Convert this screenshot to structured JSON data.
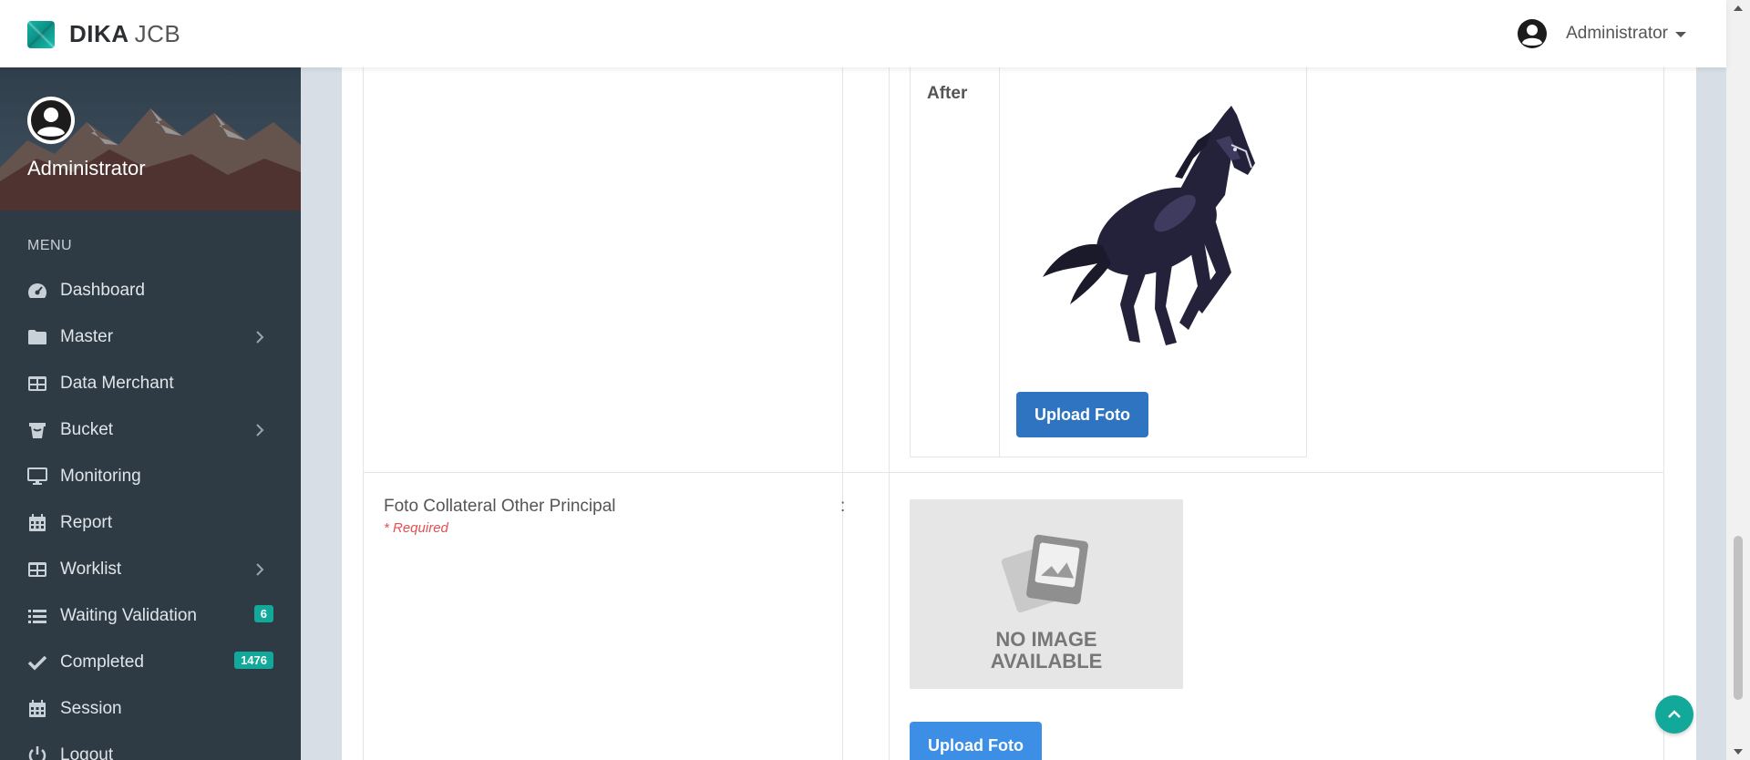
{
  "brand": {
    "name": "DIKA",
    "sub": "JCB"
  },
  "header": {
    "user_name": "Administrator"
  },
  "sidebar": {
    "profile_name": "Administrator",
    "menu_title": "MENU",
    "items": [
      {
        "label": "Dashboard",
        "icon": "dashboard-icon"
      },
      {
        "label": "Master",
        "icon": "folder-icon",
        "has_submenu": true
      },
      {
        "label": "Data Merchant",
        "icon": "table-icon"
      },
      {
        "label": "Bucket",
        "icon": "bucket-icon",
        "has_submenu": true
      },
      {
        "label": "Monitoring",
        "icon": "monitor-icon"
      },
      {
        "label": "Report",
        "icon": "calendar-icon"
      },
      {
        "label": "Worklist",
        "icon": "table-icon",
        "has_submenu": true
      },
      {
        "label": "Waiting Validation",
        "icon": "list-icon",
        "badge": "6"
      },
      {
        "label": "Completed",
        "icon": "check-icon",
        "badge": "1476"
      },
      {
        "label": "Session",
        "icon": "calendar-icon"
      },
      {
        "label": "Logout",
        "icon": "power-icon"
      }
    ]
  },
  "form": {
    "after_label": "After",
    "upload_label": "Upload Foto",
    "field2": {
      "label": "Foto Collateral Other Principal",
      "required": "* Required",
      "colon": ":",
      "placeholder_line1": "NO IMAGE",
      "placeholder_line2": "AVAILABLE",
      "upload_label": "Upload Foto"
    }
  },
  "colors": {
    "accent": "#12a89a",
    "sidebar_bg": "#2f3b44",
    "primary_dark": "#2f74c0",
    "primary_light": "#3d8fe6"
  }
}
